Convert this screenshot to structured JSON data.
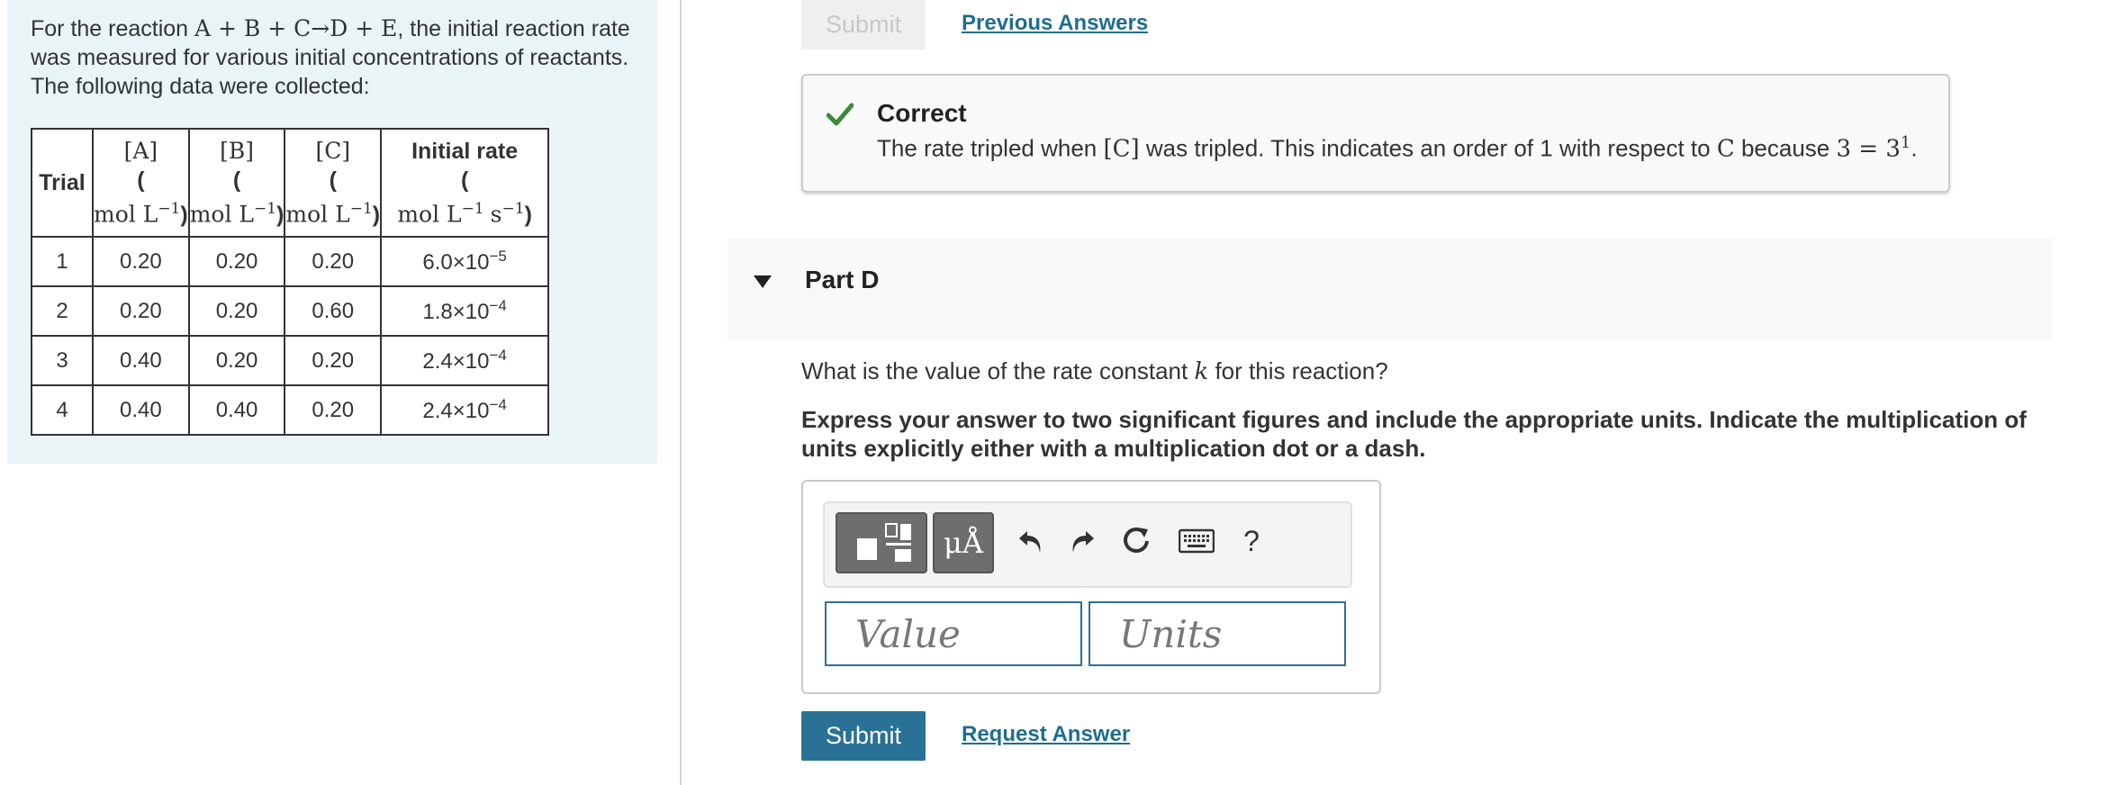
{
  "problem": {
    "intro_prefix": "For the reaction ",
    "reaction": "A + B + C→D + E",
    "intro_suffix": ", the initial reaction rate was measured for various initial concentrations of reactants. The following data were collected:"
  },
  "table": {
    "headers": {
      "trial": "Trial",
      "a": "[A]",
      "b": "[B]",
      "c": "[C]",
      "rate": "Initial rate",
      "paren_open": "(",
      "paren_close": ")",
      "conc_unit": "mol L",
      "conc_exp": "−1",
      "rate_unit_a": "mol L",
      "rate_unit_b": "s"
    },
    "rows": [
      {
        "trial": "1",
        "a": "0.20",
        "b": "0.20",
        "c": "0.20",
        "rate": "6.0×10",
        "rate_exp": "−5"
      },
      {
        "trial": "2",
        "a": "0.20",
        "b": "0.20",
        "c": "0.60",
        "rate": "1.8×10",
        "rate_exp": "−4"
      },
      {
        "trial": "3",
        "a": "0.40",
        "b": "0.20",
        "c": "0.20",
        "rate": "2.4×10",
        "rate_exp": "−4"
      },
      {
        "trial": "4",
        "a": "0.40",
        "b": "0.40",
        "c": "0.20",
        "rate": "2.4×10",
        "rate_exp": "−4"
      }
    ]
  },
  "top_actions": {
    "submit_label": "Submit",
    "previous_answers": "Previous Answers"
  },
  "feedback": {
    "title": "Correct",
    "msg_a": "The rate tripled when ",
    "msg_conc": "[C]",
    "msg_b": " was tripled. This indicates an order of 1 with respect to ",
    "msg_species": "C",
    "msg_c": " because ",
    "msg_eq": "3 = 3",
    "msg_exp": "1",
    "msg_end": "."
  },
  "part_d": {
    "label": "Part D",
    "question_a": "What is the value of the rate constant ",
    "question_var": "k",
    "question_b": " for this reaction?",
    "instructions": "Express your answer to two significant figures and include the appropriate units. Indicate the multiplication of units explicitly either with a multiplication dot or a dash."
  },
  "answer": {
    "symbols_label": "μÅ",
    "help_label": "?",
    "value_placeholder": "Value",
    "units_placeholder": "Units",
    "submit_label": "Submit",
    "request_answer": "Request Answer"
  },
  "colors": {
    "panel_bg": "#e8f4f6",
    "link": "#1f6d8f",
    "submit": "#2a7196",
    "correct_green": "#3a8a3a"
  }
}
